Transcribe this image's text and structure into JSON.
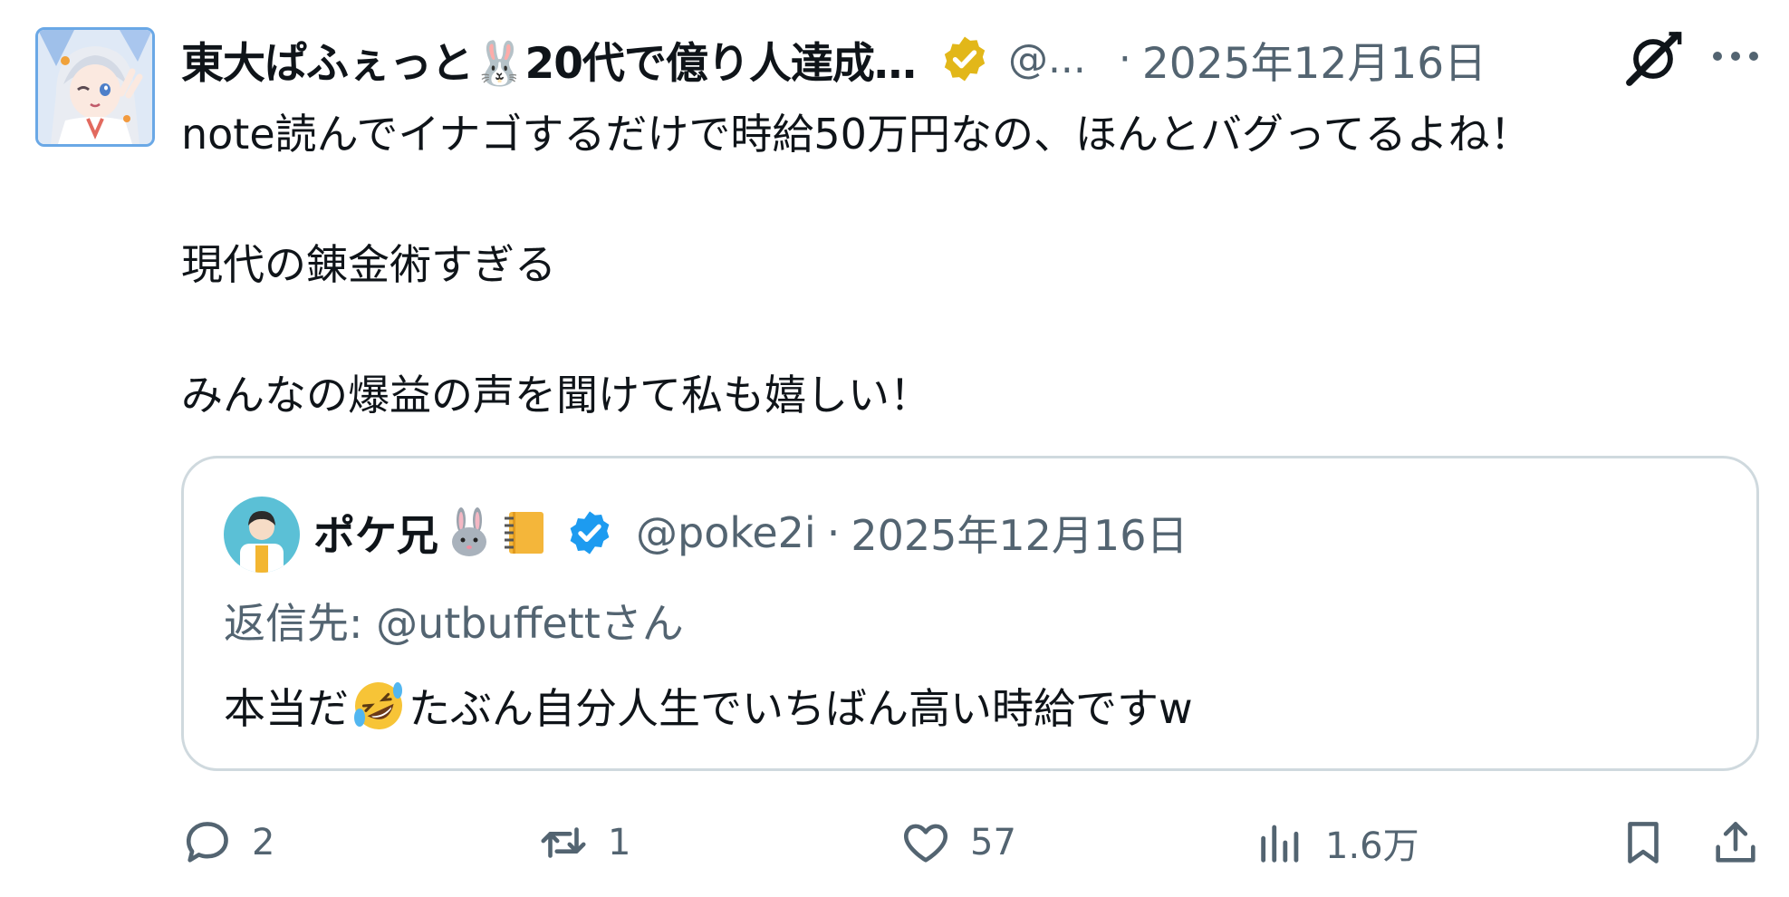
{
  "tweet": {
    "author": {
      "display_name": "東大ぱふぇっと🐰20代で億り人達成…",
      "handle": "@...",
      "verified_badge": "gold-check-badge-icon"
    },
    "timestamp": "2025年12月16日",
    "separator": "·",
    "grok_icon": "grok-icon",
    "more_icon": "more-options-icon",
    "body_lines": [
      "note読んでイナゴするだけで時給50万円なの、ほんとバグってるよね！",
      "",
      "現代の錬金術すぎる",
      "",
      "みんなの爆益の声を聞けて私も嬉しい！"
    ]
  },
  "quote": {
    "author": {
      "display_name": "ポケ兄",
      "emojis": [
        "rabbit-icon",
        "notebook-icon"
      ],
      "verified_badge": "blue-check-badge-icon",
      "handle": "@poke2i"
    },
    "separator": "·",
    "timestamp": "2025年12月16日",
    "reply_to": "返信先: @utbuffettさん",
    "text_before_emoji": "本当だ",
    "emoji": "rolling-laughing-emoji",
    "text_after_emoji": "たぶん自分人生でいちばん高い時給ですw"
  },
  "actions": {
    "reply": {
      "icon": "reply-icon",
      "count": "2"
    },
    "repost": {
      "icon": "repost-icon",
      "count": "1"
    },
    "like": {
      "icon": "heart-icon",
      "count": "57"
    },
    "views": {
      "icon": "views-chart-icon",
      "count": "1.6万"
    },
    "bookmark": {
      "icon": "bookmark-icon"
    },
    "share": {
      "icon": "share-icon"
    }
  },
  "colors": {
    "text_primary": "#0f1419",
    "text_secondary": "#536471",
    "border": "#cfd9de",
    "verified_blue": "#1d9bf0",
    "verified_gold": "#e2b719"
  }
}
